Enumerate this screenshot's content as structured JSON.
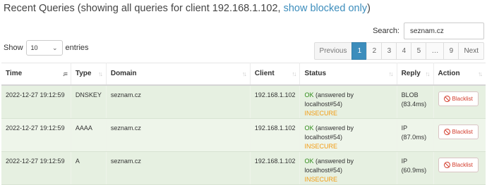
{
  "header": {
    "title_prefix": "Recent Queries (showing all queries for client 192.168.1.102,",
    "title_link": "show blocked only",
    "title_suffix": ")"
  },
  "search": {
    "label": "Search:",
    "value": "seznam.cz"
  },
  "length": {
    "show_label": "Show",
    "selected": "10",
    "entries_label": "entries"
  },
  "pagination": {
    "previous": "Previous",
    "pages": [
      "1",
      "2",
      "3",
      "4",
      "5",
      "…",
      "9"
    ],
    "active_page": "1",
    "next": "Next"
  },
  "table": {
    "columns": [
      "Time",
      "Type",
      "Domain",
      "Client",
      "Status",
      "Reply",
      "Action"
    ],
    "sorted_column": "Time",
    "rows": [
      {
        "time": "2022-12-27 19:12:59",
        "type": "DNSKEY",
        "domain": "seznam.cz",
        "client": "192.168.1.102",
        "status_ok": "OK",
        "status_detail": "(answered by localhost#54)",
        "status_dnssec": "INSECURE",
        "reply_type": "BLOB",
        "reply_time": "(83.4ms)",
        "action": "Blacklist"
      },
      {
        "time": "2022-12-27 19:12:59",
        "type": "AAAA",
        "domain": "seznam.cz",
        "client": "192.168.1.102",
        "status_ok": "OK",
        "status_detail": "(answered by localhost#54)",
        "status_dnssec": "INSECURE",
        "reply_type": "IP",
        "reply_time": "(87.0ms)",
        "action": "Blacklist"
      },
      {
        "time": "2022-12-27 19:12:59",
        "type": "A",
        "domain": "seznam.cz",
        "client": "192.168.1.102",
        "status_ok": "OK",
        "status_detail": "(answered by localhost#54)",
        "status_dnssec": "INSECURE",
        "reply_type": "IP",
        "reply_time": "(60.9ms)",
        "action": "Blacklist"
      }
    ]
  },
  "colors": {
    "link": "#3c8dbc",
    "ok": "#2e8b17",
    "insecure": "#f39c12",
    "row_bg": "#e6f0e1",
    "blacklist": "#d33b2b",
    "active_page": "#3c8dbc"
  },
  "icons": {
    "sort": "sort-arrows-icon",
    "sort_active": "sort-numeric-down-icon",
    "ban": "ban-icon",
    "dropdown": "chevron-down-icon"
  }
}
